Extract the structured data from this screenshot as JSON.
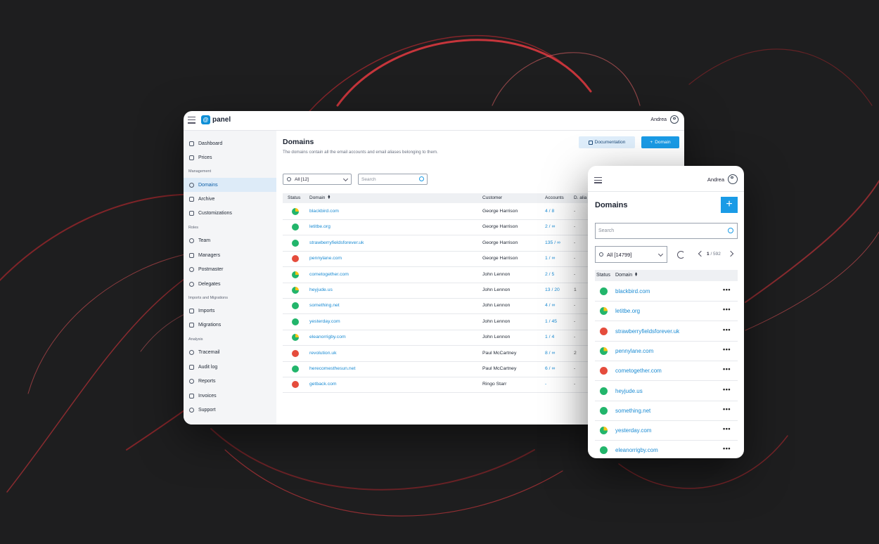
{
  "colors": {
    "green": "#22b56b",
    "red": "#e54c3c",
    "yellow": "#f5c518",
    "accent": "#1a9be6"
  },
  "desktop": {
    "header": {
      "logo_text": "panel",
      "user": "Andrea"
    },
    "sidebar": {
      "groups": [
        {
          "section": "",
          "items": [
            "Dashboard",
            "Prices"
          ]
        },
        {
          "section": "Management",
          "items": [
            "Domains",
            "Archive",
            "Customizations"
          ]
        },
        {
          "section": "Roles",
          "items": [
            "Team",
            "Managers",
            "Postmaster",
            "Delegates"
          ]
        },
        {
          "section": "Imports and Migrations",
          "items": [
            "Imports",
            "Migrations"
          ]
        },
        {
          "section": "Analysis",
          "items": [
            "Tracemail",
            "Audit log",
            "Reports",
            "Invoices",
            "Support"
          ]
        }
      ]
    },
    "main": {
      "title": "Domains",
      "subtitle": "The domains contain all the email accounts and email aliases belonging to them.",
      "doc_button": "Documentation",
      "add_button": "Domain",
      "filter": "All [12]",
      "search_placeholder": "Search",
      "columns": [
        "Status",
        "Domain",
        "Customer",
        "Accounts",
        "D. alia"
      ],
      "rows": [
        {
          "status": "partial",
          "domain": "blackbird.com",
          "customer": "George Harrison",
          "accounts": "4 / 8",
          "alias": "-"
        },
        {
          "status": "green",
          "domain": "letitbe.org",
          "customer": "George Harrison",
          "accounts": "2 / ∞",
          "alias": "-"
        },
        {
          "status": "green",
          "domain": "strawberryfieldsforever.uk",
          "customer": "George Harrison",
          "accounts": "135 / ∞",
          "alias": "-"
        },
        {
          "status": "red",
          "domain": "pennylane.com",
          "customer": "George Harrison",
          "accounts": "1 / ∞",
          "alias": "-"
        },
        {
          "status": "partial",
          "domain": "cometogether.com",
          "customer": "John Lennon",
          "accounts": "2 / 5",
          "alias": "-"
        },
        {
          "status": "partial",
          "domain": "heyjude.us",
          "customer": "John Lennon",
          "accounts": "13 / 20",
          "alias": "1"
        },
        {
          "status": "green",
          "domain": "something.net",
          "customer": "John Lennon",
          "accounts": "4 / ∞",
          "alias": "-"
        },
        {
          "status": "green",
          "domain": "yesterday.com",
          "customer": "John Lennon",
          "accounts": "1 / 45",
          "alias": "-"
        },
        {
          "status": "partial",
          "domain": "eleanorrigby.com",
          "customer": "John Lennon",
          "accounts": "1 / 4",
          "alias": "-"
        },
        {
          "status": "red",
          "domain": "revolution.uk",
          "customer": "Paul McCartney",
          "accounts": "8 / ∞",
          "alias": "2"
        },
        {
          "status": "green",
          "domain": "herecomesthesun.net",
          "customer": "Paul McCartney",
          "accounts": "6 / ∞",
          "alias": "-"
        },
        {
          "status": "red",
          "domain": "getback.com",
          "customer": "Ringo Starr",
          "accounts": "-",
          "alias": "-"
        }
      ]
    }
  },
  "mobile": {
    "user": "Andrea",
    "title": "Domains",
    "add_symbol": "+",
    "search_placeholder": "Search",
    "filter": "All [14799]",
    "page_current": "1",
    "page_total": "/ 592",
    "columns": [
      "Status",
      "Domain"
    ],
    "more_symbol": "•••",
    "rows": [
      {
        "status": "green",
        "domain": "blackbird.com"
      },
      {
        "status": "partial",
        "domain": "letitbe.org"
      },
      {
        "status": "red",
        "domain": "strawberryfieldsforever.uk"
      },
      {
        "status": "partial",
        "domain": "pennylane.com"
      },
      {
        "status": "red",
        "domain": "cometogether.com"
      },
      {
        "status": "green",
        "domain": "heyjude.us"
      },
      {
        "status": "green",
        "domain": "something.net"
      },
      {
        "status": "partial",
        "domain": "yesterday.com"
      },
      {
        "status": "green",
        "domain": "eleanorrigby.com"
      }
    ]
  }
}
